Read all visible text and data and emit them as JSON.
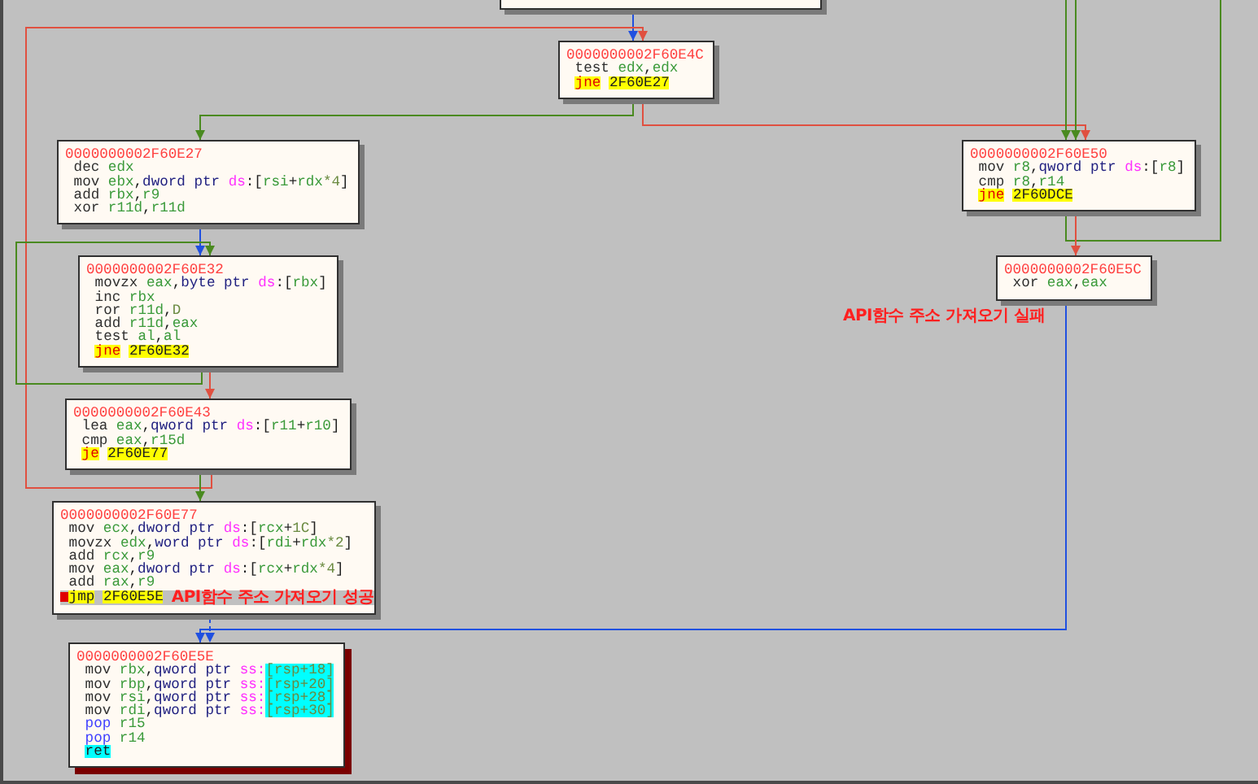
{
  "blocks": [
    {
      "address": "0000000002F60E4C",
      "selected": false,
      "lines": [
        {
          "selected": false,
          "breakpoint": false,
          "tokens": [
            {
              "kind": "mnemonic",
              "text": "test "
            },
            {
              "kind": "register",
              "text": "edx"
            },
            {
              "kind": "plain",
              "text": ","
            },
            {
              "kind": "register",
              "text": "edx"
            }
          ]
        },
        {
          "selected": false,
          "breakpoint": false,
          "tokens": [
            {
              "kind": "jump",
              "text": "jne"
            },
            {
              "kind": "target",
              "text": "2F60E27"
            }
          ]
        }
      ]
    },
    {
      "address": "0000000002F60E27",
      "selected": false,
      "lines": [
        {
          "selected": false,
          "breakpoint": false,
          "tokens": [
            {
              "kind": "mnemonic",
              "text": "dec "
            },
            {
              "kind": "register",
              "text": "edx"
            }
          ]
        },
        {
          "selected": false,
          "breakpoint": false,
          "tokens": [
            {
              "kind": "mnemonic",
              "text": "mov "
            },
            {
              "kind": "register",
              "text": "ebx"
            },
            {
              "kind": "plain",
              "text": ","
            },
            {
              "kind": "ptr",
              "text": "dword ptr "
            },
            {
              "kind": "segment",
              "text": "ds"
            },
            {
              "kind": "plain",
              "text": ":["
            },
            {
              "kind": "register",
              "text": "rsi"
            },
            {
              "kind": "plain",
              "text": "+"
            },
            {
              "kind": "register",
              "text": "rdx"
            },
            {
              "kind": "number",
              "text": "*4"
            },
            {
              "kind": "plain",
              "text": "]"
            }
          ]
        },
        {
          "selected": false,
          "breakpoint": false,
          "tokens": [
            {
              "kind": "mnemonic",
              "text": "add "
            },
            {
              "kind": "register",
              "text": "rbx"
            },
            {
              "kind": "plain",
              "text": ","
            },
            {
              "kind": "register",
              "text": "r9"
            }
          ]
        },
        {
          "selected": false,
          "breakpoint": false,
          "tokens": [
            {
              "kind": "mnemonic",
              "text": "xor "
            },
            {
              "kind": "register",
              "text": "r11d"
            },
            {
              "kind": "plain",
              "text": ","
            },
            {
              "kind": "register",
              "text": "r11d"
            }
          ]
        }
      ]
    },
    {
      "address": "0000000002F60E32",
      "selected": false,
      "lines": [
        {
          "selected": false,
          "breakpoint": false,
          "tokens": [
            {
              "kind": "mnemonic",
              "text": "movzx "
            },
            {
              "kind": "register",
              "text": "eax"
            },
            {
              "kind": "plain",
              "text": ","
            },
            {
              "kind": "ptr",
              "text": "byte ptr "
            },
            {
              "kind": "segment",
              "text": "ds"
            },
            {
              "kind": "plain",
              "text": ":["
            },
            {
              "kind": "register",
              "text": "rbx"
            },
            {
              "kind": "plain",
              "text": "]"
            }
          ]
        },
        {
          "selected": false,
          "breakpoint": false,
          "tokens": [
            {
              "kind": "mnemonic",
              "text": "inc "
            },
            {
              "kind": "register",
              "text": "rbx"
            }
          ]
        },
        {
          "selected": false,
          "breakpoint": false,
          "tokens": [
            {
              "kind": "mnemonic",
              "text": "ror "
            },
            {
              "kind": "register",
              "text": "r11d"
            },
            {
              "kind": "plain",
              "text": ","
            },
            {
              "kind": "number",
              "text": "D"
            }
          ]
        },
        {
          "selected": false,
          "breakpoint": false,
          "tokens": [
            {
              "kind": "mnemonic",
              "text": "add "
            },
            {
              "kind": "register",
              "text": "r11d"
            },
            {
              "kind": "plain",
              "text": ","
            },
            {
              "kind": "register",
              "text": "eax"
            }
          ]
        },
        {
          "selected": false,
          "breakpoint": false,
          "tokens": [
            {
              "kind": "mnemonic",
              "text": "test "
            },
            {
              "kind": "register",
              "text": "al"
            },
            {
              "kind": "plain",
              "text": ","
            },
            {
              "kind": "register",
              "text": "al"
            }
          ]
        },
        {
          "selected": false,
          "breakpoint": false,
          "tokens": [
            {
              "kind": "jump",
              "text": "jne"
            },
            {
              "kind": "target",
              "text": "2F60E32"
            }
          ]
        }
      ]
    },
    {
      "address": "0000000002F60E43",
      "selected": false,
      "lines": [
        {
          "selected": false,
          "breakpoint": false,
          "tokens": [
            {
              "kind": "mnemonic",
              "text": "lea "
            },
            {
              "kind": "register",
              "text": "eax"
            },
            {
              "kind": "plain",
              "text": ","
            },
            {
              "kind": "ptr",
              "text": "qword ptr "
            },
            {
              "kind": "segment",
              "text": "ds"
            },
            {
              "kind": "plain",
              "text": ":["
            },
            {
              "kind": "register",
              "text": "r11"
            },
            {
              "kind": "plain",
              "text": "+"
            },
            {
              "kind": "register",
              "text": "r10"
            },
            {
              "kind": "plain",
              "text": "]"
            }
          ]
        },
        {
          "selected": false,
          "breakpoint": false,
          "tokens": [
            {
              "kind": "mnemonic",
              "text": "cmp "
            },
            {
              "kind": "register",
              "text": "eax"
            },
            {
              "kind": "plain",
              "text": ","
            },
            {
              "kind": "register",
              "text": "r15d"
            }
          ]
        },
        {
          "selected": false,
          "breakpoint": false,
          "tokens": [
            {
              "kind": "jump",
              "text": "je"
            },
            {
              "kind": "target",
              "text": "2F60E77"
            }
          ]
        }
      ]
    },
    {
      "address": "0000000002F60E77",
      "selected": false,
      "lines": [
        {
          "selected": false,
          "breakpoint": false,
          "tokens": [
            {
              "kind": "mnemonic",
              "text": "mov "
            },
            {
              "kind": "register",
              "text": "ecx"
            },
            {
              "kind": "plain",
              "text": ","
            },
            {
              "kind": "ptr",
              "text": "dword ptr "
            },
            {
              "kind": "segment",
              "text": "ds"
            },
            {
              "kind": "plain",
              "text": ":["
            },
            {
              "kind": "register",
              "text": "rcx"
            },
            {
              "kind": "plain",
              "text": "+"
            },
            {
              "kind": "number",
              "text": "1C"
            },
            {
              "kind": "plain",
              "text": "]"
            }
          ]
        },
        {
          "selected": false,
          "breakpoint": false,
          "tokens": [
            {
              "kind": "mnemonic",
              "text": "movzx "
            },
            {
              "kind": "register",
              "text": "edx"
            },
            {
              "kind": "plain",
              "text": ","
            },
            {
              "kind": "ptr",
              "text": "word ptr "
            },
            {
              "kind": "segment",
              "text": "ds"
            },
            {
              "kind": "plain",
              "text": ":["
            },
            {
              "kind": "register",
              "text": "rdi"
            },
            {
              "kind": "plain",
              "text": "+"
            },
            {
              "kind": "register",
              "text": "rdx"
            },
            {
              "kind": "number",
              "text": "*2"
            },
            {
              "kind": "plain",
              "text": "]"
            }
          ]
        },
        {
          "selected": false,
          "breakpoint": false,
          "tokens": [
            {
              "kind": "mnemonic",
              "text": "add "
            },
            {
              "kind": "register",
              "text": "rcx"
            },
            {
              "kind": "plain",
              "text": ","
            },
            {
              "kind": "register",
              "text": "r9"
            }
          ]
        },
        {
          "selected": false,
          "breakpoint": false,
          "tokens": [
            {
              "kind": "mnemonic",
              "text": "mov "
            },
            {
              "kind": "register",
              "text": "eax"
            },
            {
              "kind": "plain",
              "text": ","
            },
            {
              "kind": "ptr",
              "text": "dword ptr "
            },
            {
              "kind": "segment",
              "text": "ds"
            },
            {
              "kind": "plain",
              "text": ":["
            },
            {
              "kind": "register",
              "text": "rcx"
            },
            {
              "kind": "plain",
              "text": "+"
            },
            {
              "kind": "register",
              "text": "rdx"
            },
            {
              "kind": "number",
              "text": "*4"
            },
            {
              "kind": "plain",
              "text": "]"
            }
          ]
        },
        {
          "selected": false,
          "breakpoint": false,
          "tokens": [
            {
              "kind": "mnemonic",
              "text": "add "
            },
            {
              "kind": "register",
              "text": "rax"
            },
            {
              "kind": "plain",
              "text": ","
            },
            {
              "kind": "register",
              "text": "r9"
            }
          ]
        },
        {
          "selected": true,
          "breakpoint": true,
          "tokens": [
            {
              "kind": "jumpplain",
              "text": "jmp"
            },
            {
              "kind": "target",
              "text": "2F60E5E"
            }
          ],
          "comment": "API함수 주소 가져오기 성공"
        }
      ]
    },
    {
      "address": "0000000002F60E50",
      "selected": false,
      "lines": [
        {
          "selected": false,
          "breakpoint": false,
          "tokens": [
            {
              "kind": "mnemonic",
              "text": "mov "
            },
            {
              "kind": "register",
              "text": "r8"
            },
            {
              "kind": "plain",
              "text": ","
            },
            {
              "kind": "ptr",
              "text": "qword ptr "
            },
            {
              "kind": "segment",
              "text": "ds"
            },
            {
              "kind": "plain",
              "text": ":["
            },
            {
              "kind": "register",
              "text": "r8"
            },
            {
              "kind": "plain",
              "text": "]"
            }
          ]
        },
        {
          "selected": false,
          "breakpoint": false,
          "tokens": [
            {
              "kind": "mnemonic",
              "text": "cmp "
            },
            {
              "kind": "register",
              "text": "r8"
            },
            {
              "kind": "plain",
              "text": ","
            },
            {
              "kind": "register",
              "text": "r14"
            }
          ]
        },
        {
          "selected": false,
          "breakpoint": false,
          "tokens": [
            {
              "kind": "jump",
              "text": "jne"
            },
            {
              "kind": "target",
              "text": "2F60DCE"
            }
          ]
        }
      ]
    },
    {
      "address": "0000000002F60E5C",
      "selected": false,
      "lines": [
        {
          "selected": false,
          "breakpoint": false,
          "tokens": [
            {
              "kind": "mnemonic",
              "text": "xor "
            },
            {
              "kind": "register",
              "text": "eax"
            },
            {
              "kind": "plain",
              "text": ","
            },
            {
              "kind": "register",
              "text": "eax"
            }
          ]
        }
      ]
    },
    {
      "address": "0000000002F60E5E",
      "selected": true,
      "lines": [
        {
          "selected": false,
          "breakpoint": false,
          "tokens": [
            {
              "kind": "mnemonic",
              "text": "mov "
            },
            {
              "kind": "register",
              "text": "rbx"
            },
            {
              "kind": "plain",
              "text": ","
            },
            {
              "kind": "ptr",
              "text": "qword ptr "
            },
            {
              "kind": "segment",
              "text": "ss:"
            },
            {
              "kind": "bracket",
              "text": "[rsp+18]"
            }
          ]
        },
        {
          "selected": false,
          "breakpoint": false,
          "tokens": [
            {
              "kind": "mnemonic",
              "text": "mov "
            },
            {
              "kind": "register",
              "text": "rbp"
            },
            {
              "kind": "plain",
              "text": ","
            },
            {
              "kind": "ptr",
              "text": "qword ptr "
            },
            {
              "kind": "segment",
              "text": "ss:"
            },
            {
              "kind": "bracket",
              "text": "[rsp+20]"
            }
          ]
        },
        {
          "selected": false,
          "breakpoint": false,
          "tokens": [
            {
              "kind": "mnemonic",
              "text": "mov "
            },
            {
              "kind": "register",
              "text": "rsi"
            },
            {
              "kind": "plain",
              "text": ","
            },
            {
              "kind": "ptr",
              "text": "qword ptr "
            },
            {
              "kind": "segment",
              "text": "ss:"
            },
            {
              "kind": "bracket",
              "text": "[rsp+28]"
            }
          ]
        },
        {
          "selected": false,
          "breakpoint": false,
          "tokens": [
            {
              "kind": "mnemonic",
              "text": "mov "
            },
            {
              "kind": "register",
              "text": "rdi"
            },
            {
              "kind": "plain",
              "text": ","
            },
            {
              "kind": "ptr",
              "text": "qword ptr "
            },
            {
              "kind": "segment",
              "text": "ss:"
            },
            {
              "kind": "bracket",
              "text": "[rsp+30]"
            }
          ]
        },
        {
          "selected": false,
          "breakpoint": false,
          "tokens": [
            {
              "kind": "stack",
              "text": "pop "
            },
            {
              "kind": "register",
              "text": "r15"
            }
          ]
        },
        {
          "selected": false,
          "breakpoint": false,
          "tokens": [
            {
              "kind": "stack",
              "text": "pop "
            },
            {
              "kind": "register",
              "text": "r14"
            }
          ]
        },
        {
          "selected": false,
          "breakpoint": false,
          "tokens": [
            {
              "kind": "return",
              "text": "ret"
            }
          ]
        }
      ]
    }
  ],
  "annotations": [
    "API함수 주소 가져오기 실패"
  ]
}
